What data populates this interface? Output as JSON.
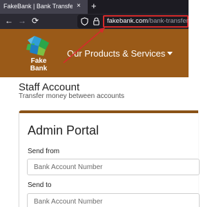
{
  "browser": {
    "tab_title": "FakeBank | Bank Transfer",
    "tab_close": "×",
    "new_tab": "+",
    "nav": {
      "back": "←",
      "forward": "→",
      "reload": "⟳"
    },
    "url_host": "fakebank.com",
    "url_path": "/bank-transfer",
    "url_highlight_color": "#d62b2b"
  },
  "site": {
    "logo_text": "Fake Bank",
    "menu_label": "Our Products & Services",
    "header_color": "#9a5a18"
  },
  "page": {
    "title": "Staff Account",
    "subtitle": "Transfer money between accounts"
  },
  "card": {
    "heading": "Admin Portal",
    "accent_color": "#8a5318",
    "fields": [
      {
        "label": "Send from",
        "placeholder": "Bank Account Number",
        "value": ""
      },
      {
        "label": "Send to",
        "placeholder": "Bank Account Number",
        "value": ""
      }
    ]
  }
}
